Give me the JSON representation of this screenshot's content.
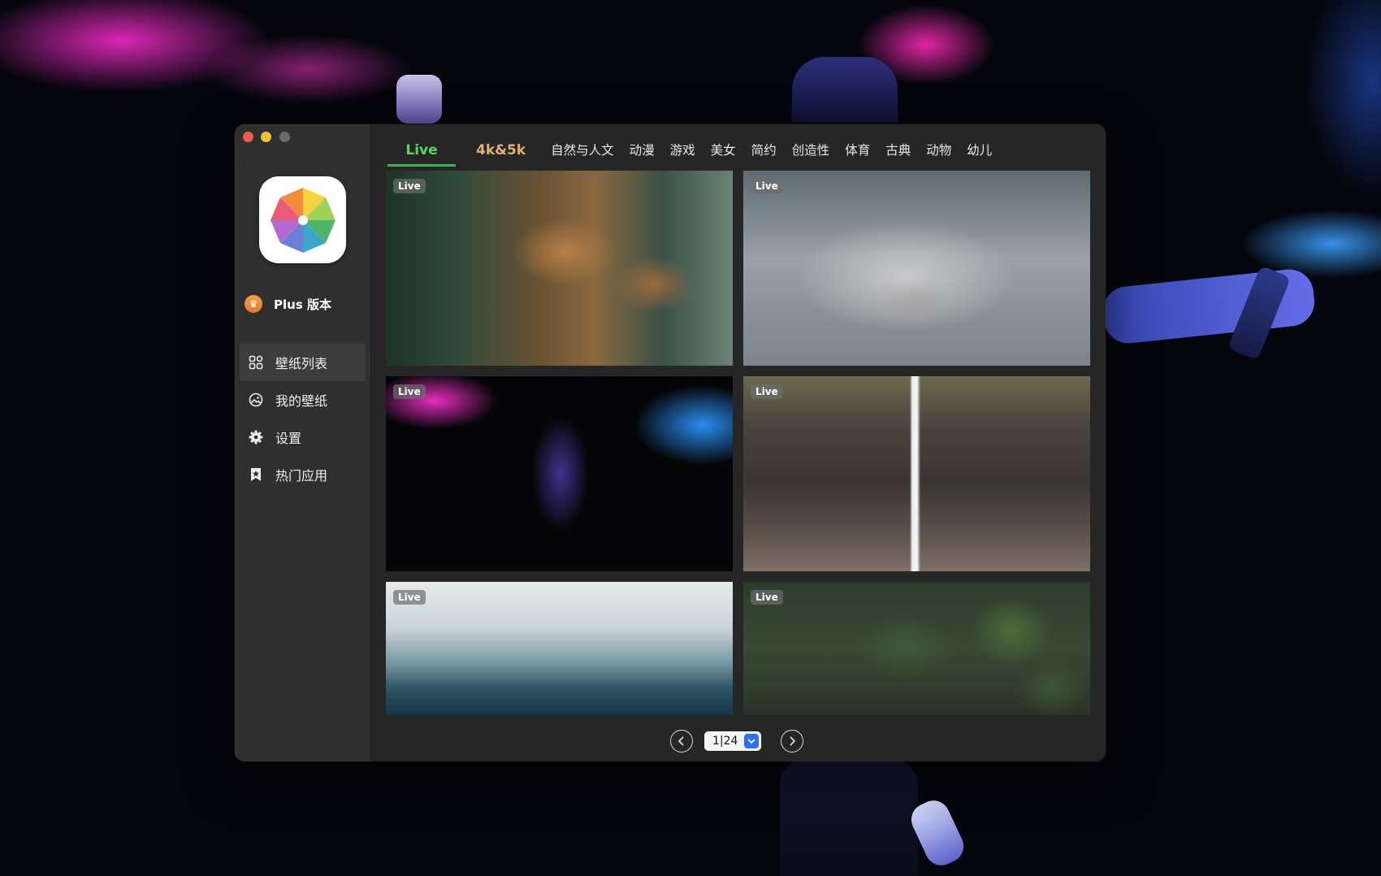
{
  "app": {
    "plus_label": "Plus 版本"
  },
  "sidebar": {
    "items": [
      {
        "label": "壁纸列表",
        "icon": "grid-icon",
        "active": true
      },
      {
        "label": "我的壁纸",
        "icon": "image-icon",
        "active": false
      },
      {
        "label": "设置",
        "icon": "gear-icon",
        "active": false
      },
      {
        "label": "热门应用",
        "icon": "bookmark-star-icon",
        "active": false
      }
    ]
  },
  "tabs": [
    {
      "label": "Live",
      "active": true
    },
    {
      "label": "4k&5k"
    },
    {
      "label": "自然与人文"
    },
    {
      "label": "动漫"
    },
    {
      "label": "游戏"
    },
    {
      "label": "美女"
    },
    {
      "label": "简约"
    },
    {
      "label": "创造性"
    },
    {
      "label": "体育"
    },
    {
      "label": "古典"
    },
    {
      "label": "动物"
    },
    {
      "label": "幼儿"
    }
  ],
  "wallpapers": [
    {
      "badge": "Live"
    },
    {
      "badge": "Live"
    },
    {
      "badge": "Live"
    },
    {
      "badge": "Live"
    },
    {
      "badge": "Live"
    },
    {
      "badge": "Live"
    }
  ],
  "pagination": {
    "page_display": "1|24",
    "prev_icon": "chevron-left-icon",
    "next_icon": "chevron-right-icon"
  },
  "colors": {
    "active_tab": "#5bd36a",
    "highlight_tab": "#e0b172",
    "window_bg": "#262626",
    "sidebar_bg": "#2f2f2f",
    "select_accent": "#2f6ff0"
  }
}
